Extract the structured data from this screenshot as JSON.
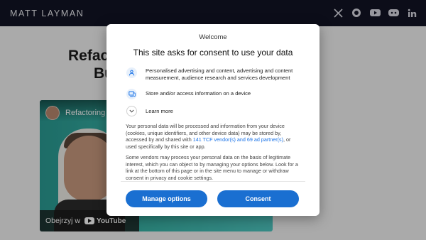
{
  "site": {
    "brand": "MATT LAYMAN",
    "social_icons": [
      "x-icon",
      "github-icon",
      "youtube-icon",
      "discord-icon",
      "linkedin-icon"
    ]
  },
  "post": {
    "title_line1": "Refac",
    "title_line2": "Bu",
    "video_title": "Refactoring",
    "watch_on_label": "Obejrzyj w",
    "youtube_label": "YouTube"
  },
  "consent": {
    "welcome": "Welcome",
    "title": "This site asks for consent to use your data",
    "purposes": [
      {
        "icon": "person-icon",
        "text": "Personalised advertising and content, advertising and content measurement, audience research and services development"
      },
      {
        "icon": "device-icon",
        "text": "Store and/or access information on a device"
      }
    ],
    "learn_more": "Learn more",
    "paragraph1_a": "Your personal data will be processed and information from your device (cookies, unique identifiers, and other device data) may be stored by, accessed by and shared with ",
    "paragraph1_link": "141 TCF vendor(s) and 69 ad partner(s)",
    "paragraph1_b": ", or used specifically by this site or app.",
    "paragraph2": "Some vendors may process your personal data on the basis of legitimate interest, which you can object to by managing your options below. Look for a link at the bottom of this page or in the site menu to manage or withdraw consent in privacy and cookie settings.",
    "manage_button": "Manage options",
    "consent_button": "Consent"
  },
  "colors": {
    "accent": "#1a6fd1",
    "header_bg": "#121424",
    "overlay": "rgba(0,0,0,0.3)"
  }
}
